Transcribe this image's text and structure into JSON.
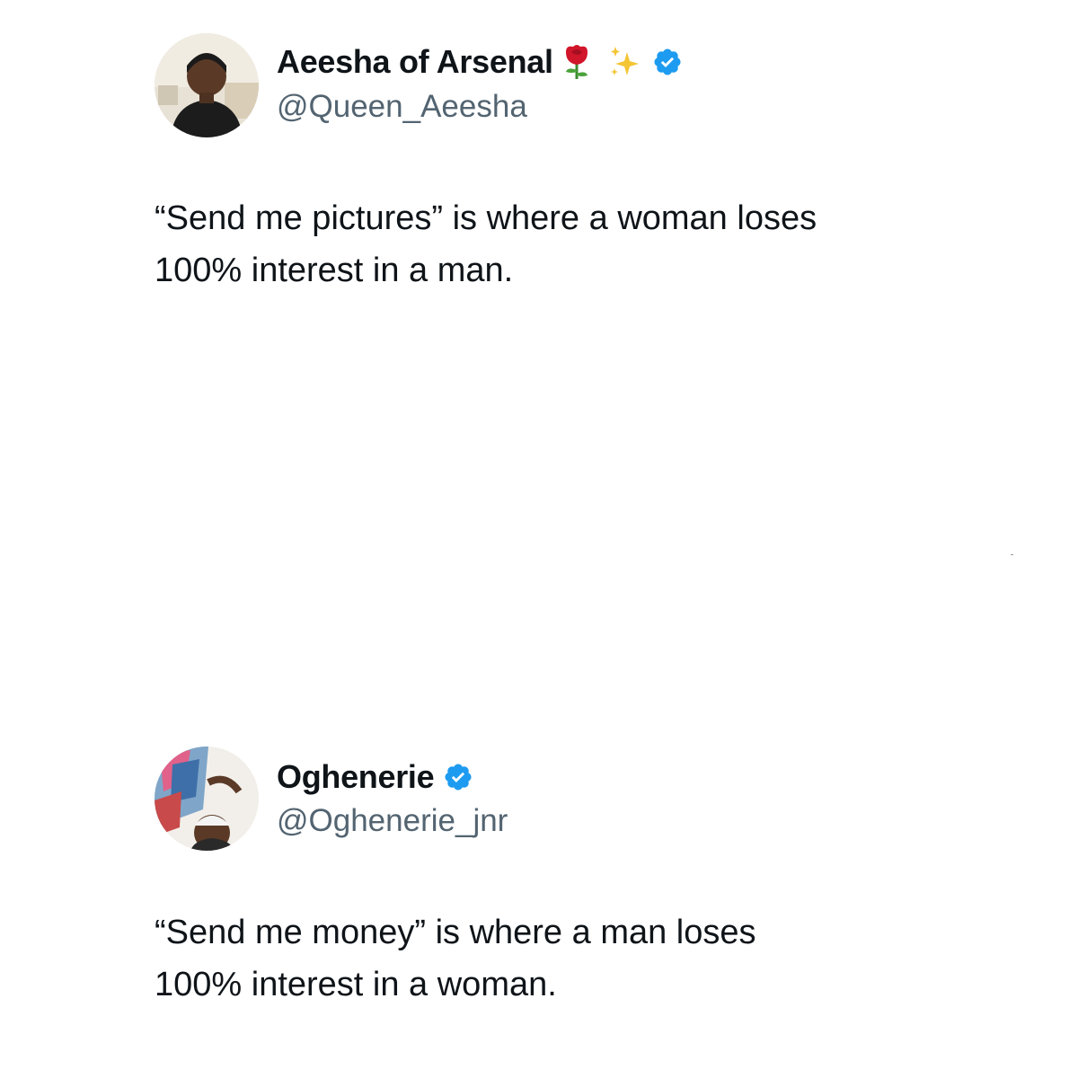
{
  "tweets": [
    {
      "display_name": "Aeesha of Arsenal",
      "name_emojis": [
        "rose-icon",
        "sparkles-icon"
      ],
      "verified": true,
      "handle": "@Queen_Aeesha",
      "text_lines": [
        "“Send me pictures” is where a woman loses",
        "100% interest in a man."
      ]
    },
    {
      "display_name": "Oghenerie",
      "name_emojis": [],
      "verified": true,
      "handle": "@Oghenerie_jnr",
      "text_lines": [
        "“Send me money” is where a man loses",
        "100% interest in a woman."
      ]
    }
  ],
  "colors": {
    "verified_blue": "#1d9bf0",
    "handle_gray": "#536471",
    "text": "#0f1419"
  }
}
